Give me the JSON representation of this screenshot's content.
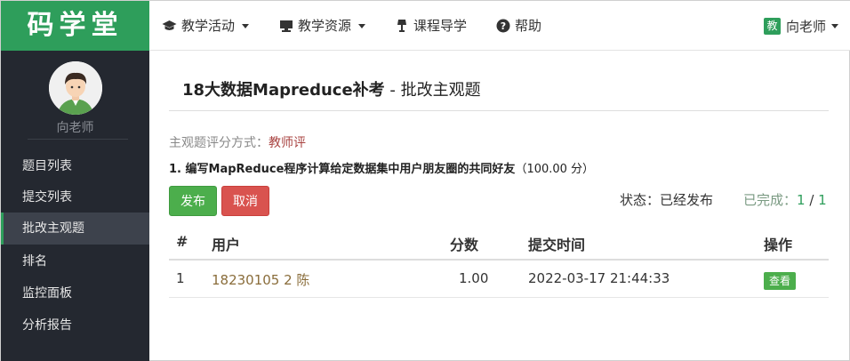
{
  "brand": {
    "logo": "码学堂"
  },
  "nav": {
    "items": [
      {
        "label": "教学活动",
        "icon": "graduation-cap-icon",
        "dropdown": true
      },
      {
        "label": "教学资源",
        "icon": "monitor-icon",
        "dropdown": true
      },
      {
        "label": "课程导学",
        "icon": "lamp-icon",
        "dropdown": false
      },
      {
        "label": "帮助",
        "icon": "question-circle-icon",
        "dropdown": false
      }
    ],
    "user": {
      "badge": "教",
      "name": "向老师"
    }
  },
  "sidebar": {
    "user_name": "向老师",
    "items": [
      {
        "label": "题目列表",
        "active": false
      },
      {
        "label": "提交列表",
        "active": false
      },
      {
        "label": "批改主观题",
        "active": true
      },
      {
        "label": "排名",
        "active": false
      },
      {
        "label": "监控面板",
        "active": false
      },
      {
        "label": "分析报告",
        "active": false
      }
    ]
  },
  "main": {
    "exam_title": "18大数据Mapreduce补考",
    "page_subtitle": " - 批改主观题",
    "grading_method_label": "主观题评分方式：",
    "grading_method_value": "教师评",
    "question_text": "1. 编写MapReduce程序计算给定数据集中用户朋友圈的共同好友",
    "question_score": "（100.00 分）",
    "publish_label": "发布",
    "cancel_label": "取消",
    "status_text": "状态：已经发布",
    "completed_label": "已完成：",
    "completed_done": "1",
    "completed_sep": " / ",
    "completed_total": "1"
  },
  "table": {
    "headers": [
      "#",
      "用户",
      "分数",
      "提交时间",
      "操作"
    ],
    "rows": [
      {
        "index": "1",
        "user": "18230105    2 陈",
        "score": "1.00",
        "submit_time": "2022-03-17 21:44:33",
        "action": "查看"
      }
    ]
  },
  "colors": {
    "brand": "#2e9e5b",
    "sidebar_bg": "#242830",
    "danger": "#d9534f",
    "success": "#4cae4c"
  }
}
